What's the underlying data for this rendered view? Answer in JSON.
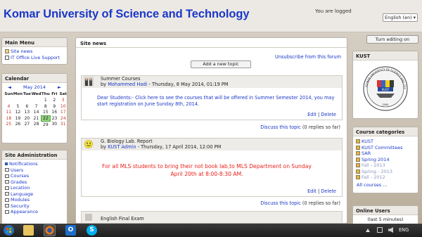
{
  "header": {
    "site_title": "Komar University of Science and Technology",
    "logged_text": "You are logged",
    "language": "English (en)"
  },
  "turn_editing_label": "Turn editing on",
  "main_menu": {
    "title": "Main Menu",
    "items": [
      "Site news",
      "IT Office Live Support"
    ]
  },
  "calendar": {
    "title": "Calendar",
    "month": "May 2014",
    "prev": "◄",
    "next": "►",
    "days": [
      "Sun",
      "Mon",
      "Tue",
      "Wed",
      "Thu",
      "Fri",
      "Sat"
    ],
    "weeks": [
      [
        "",
        "",
        "",
        "",
        "1",
        "2",
        "3"
      ],
      [
        "4",
        "5",
        "6",
        "7",
        "8",
        "9",
        "10"
      ],
      [
        "11",
        "12",
        "13",
        "14",
        "15",
        "16",
        "17"
      ],
      [
        "18",
        "19",
        "20",
        "21",
        "22",
        "23",
        "24"
      ],
      [
        "25",
        "26",
        "27",
        "28",
        "29",
        "30",
        "31"
      ]
    ],
    "today": "22"
  },
  "site_admin": {
    "title": "Site Administration",
    "items": [
      "Notifications",
      "Users",
      "Courses",
      "Grades",
      "Location",
      "Language",
      "Modules",
      "Security",
      "Appearance"
    ]
  },
  "news": {
    "title": "Site news",
    "unsubscribe": "Unsubscribe from this forum",
    "add_topic": "Add a new topic",
    "posts": [
      {
        "subject": "Summer Courses",
        "by": "by",
        "author": "Mohammed Hadi",
        "date": " - Thursday, 8 May 2014, 01:19 PM",
        "body": "Dear Students:- Click here to see the courses that will be offered in Summer Semester 2014, you may start registration on June Sunday 8th, 2014.",
        "edit": "Edit",
        "sep": " | ",
        "delete": "Delete",
        "discuss": "Discuss this topic",
        "replies": " (0 replies so far)"
      },
      {
        "subject": "G. Biology Lab. Report",
        "by": "by",
        "author": "KUST Admin",
        "date": " - Thursday, 17 April 2014, 12:00 PM",
        "body": "For all MLS students to bring their not book lab,to MLS Department on Sunday April 20th at 8:00-8:30 AM.",
        "edit": "Edit",
        "sep": " | ",
        "delete": "Delete",
        "discuss": "Discuss this topic",
        "replies": " (0 replies so far)"
      },
      {
        "subject": "English Final Exam"
      }
    ]
  },
  "kust_block": {
    "title": "KUST",
    "seal_text": "KOMAR UNIVERSITY OF SCIENCE AND TECHNOLOGY",
    "seal_label": "KUST",
    "seal_year": "2009"
  },
  "course_categories": {
    "title": "Course categories",
    "items": [
      "KUST",
      "KUST Committees",
      "SAR",
      "Spring 2014",
      "Fall - 2013",
      "Spring - 2013",
      "Fall - 2012"
    ],
    "all_courses": "All courses ..."
  },
  "online_users": {
    "title": "Online Users",
    "subtitle": "(last 5 minutes)"
  },
  "taskbar": {
    "lang": "ENG"
  },
  "colors": {
    "link": "#1a37c8",
    "announcement_red": "#e8211b"
  }
}
